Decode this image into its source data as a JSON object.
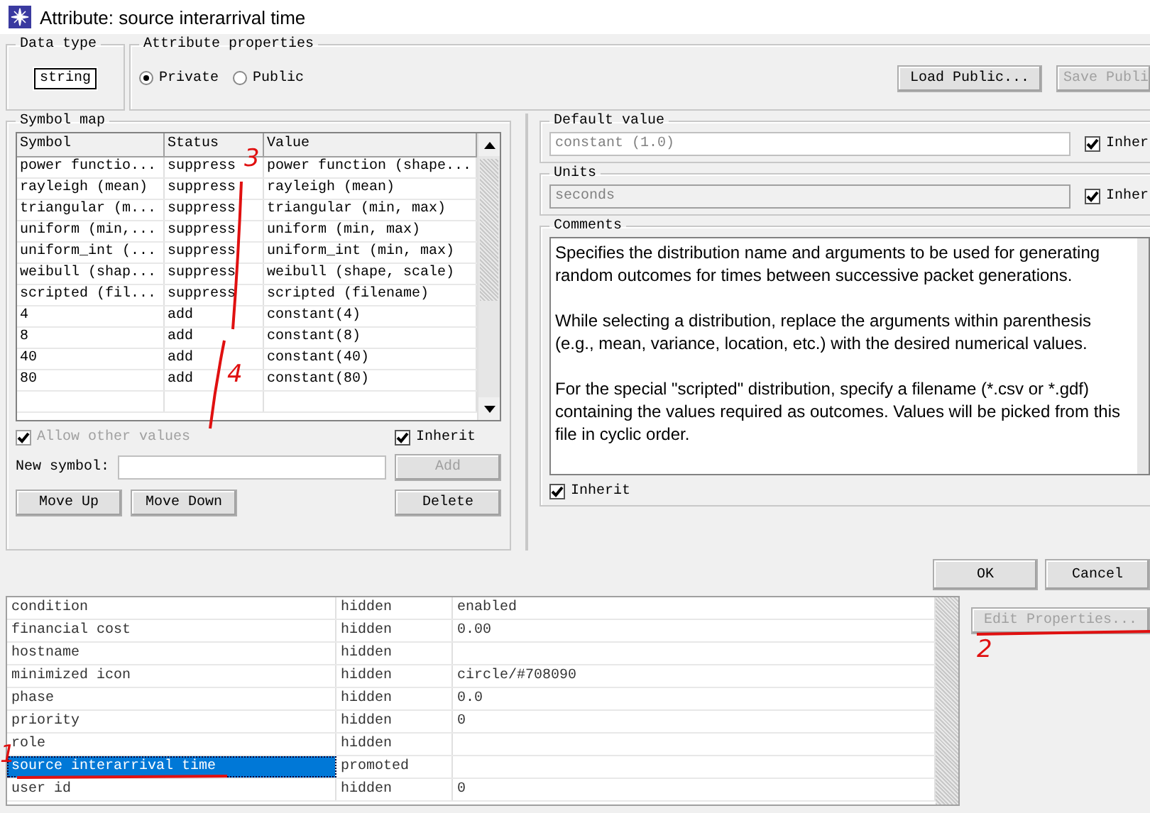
{
  "window": {
    "title": "Attribute: source interarrival time"
  },
  "data_type": {
    "label": "Data type",
    "value": "string"
  },
  "attribute_properties": {
    "label": "Attribute properties",
    "options": [
      {
        "label": "Private",
        "selected": true
      },
      {
        "label": "Public",
        "selected": false
      }
    ],
    "buttons": [
      {
        "label": "Load Public...",
        "disabled": false
      },
      {
        "label": "Save Publi",
        "disabled": true
      }
    ]
  },
  "symbol_map": {
    "label": "Symbol map",
    "columns": [
      "Symbol",
      "Status",
      "Value"
    ],
    "rows": [
      {
        "cells": [
          "power functio...",
          "suppress",
          "power function (shape..."
        ]
      },
      {
        "cells": [
          "rayleigh (mean)",
          "suppress",
          "rayleigh (mean)"
        ]
      },
      {
        "cells": [
          "triangular (m...",
          "suppress",
          "triangular (min, max)"
        ]
      },
      {
        "cells": [
          "uniform (min,...",
          "suppress",
          "uniform (min, max)"
        ]
      },
      {
        "cells": [
          "uniform_int (...",
          "suppress",
          "uniform_int (min, max)"
        ]
      },
      {
        "cells": [
          "weibull (shap...",
          "suppress",
          "weibull (shape, scale)"
        ]
      },
      {
        "cells": [
          "scripted (fil...",
          "suppress",
          "scripted (filename)"
        ]
      },
      {
        "cells": [
          "4",
          "add",
          "constant(4)"
        ]
      },
      {
        "cells": [
          "8",
          "add",
          "constant(8)"
        ]
      },
      {
        "cells": [
          "40",
          "add",
          "constant(40)"
        ]
      },
      {
        "cells": [
          "80",
          "add",
          "constant(80)"
        ]
      }
    ],
    "allow_other": {
      "label": "Allow other values",
      "checked": true,
      "disabled": true
    },
    "inherit": {
      "label": "Inherit",
      "checked": true
    },
    "new_symbol": {
      "label": "New symbol:"
    },
    "buttons": [
      {
        "label": "Add",
        "disabled": true
      },
      {
        "label": "Move Up",
        "disabled": false
      },
      {
        "label": "Move Down",
        "disabled": false
      },
      {
        "label": "Delete",
        "disabled": false
      }
    ]
  },
  "default_value": {
    "label": "Default value",
    "value": "constant (1.0)",
    "disabled": true,
    "inherit": {
      "label": "Inher",
      "checked": true
    }
  },
  "units": {
    "label": "Units",
    "value": "seconds",
    "disabled": true,
    "inherit": {
      "label": "Inher",
      "checked": true
    }
  },
  "comments": {
    "label": "Comments",
    "paragraphs": [
      "Specifies the distribution name and arguments to be used for generating random outcomes for times between successive packet generations.",
      "While selecting a distribution, replace the arguments within parenthesis (e.g., mean, variance, location, etc.) with the desired numerical values.",
      "For the special \"scripted\" distribution, specify a filename (*.csv or *.gdf) containing the values required as outcomes. Values will be picked from this file in cyclic order."
    ],
    "inherit": {
      "label": "Inherit",
      "checked": true
    }
  },
  "dialog_buttons": [
    "OK",
    "Cancel"
  ],
  "background_table": {
    "rows": [
      {
        "cells": [
          "condition",
          "hidden",
          "enabled"
        ],
        "selected": false
      },
      {
        "cells": [
          "financial cost",
          "hidden",
          "0.00"
        ],
        "selected": false
      },
      {
        "cells": [
          "hostname",
          "hidden"
        ],
        "selected": false
      },
      {
        "cells": [
          "minimized icon",
          "hidden",
          "circle/#708090"
        ],
        "selected": false
      },
      {
        "cells": [
          "phase",
          "hidden",
          "0.0"
        ],
        "selected": false
      },
      {
        "cells": [
          "priority",
          "hidden",
          "0"
        ],
        "selected": false
      },
      {
        "cells": [
          "role",
          "hidden"
        ],
        "selected": false
      },
      {
        "cells": [
          "source interarrival time",
          "promoted"
        ],
        "selected": true
      },
      {
        "cells": [
          "user id",
          "hidden",
          "0"
        ],
        "selected": false
      }
    ],
    "edit_button": {
      "label": "Edit Properties...",
      "disabled": true
    }
  },
  "annotations": [
    {
      "text": "3"
    },
    {
      "text": "4"
    },
    {
      "text": "2"
    },
    {
      "text": "1"
    }
  ]
}
